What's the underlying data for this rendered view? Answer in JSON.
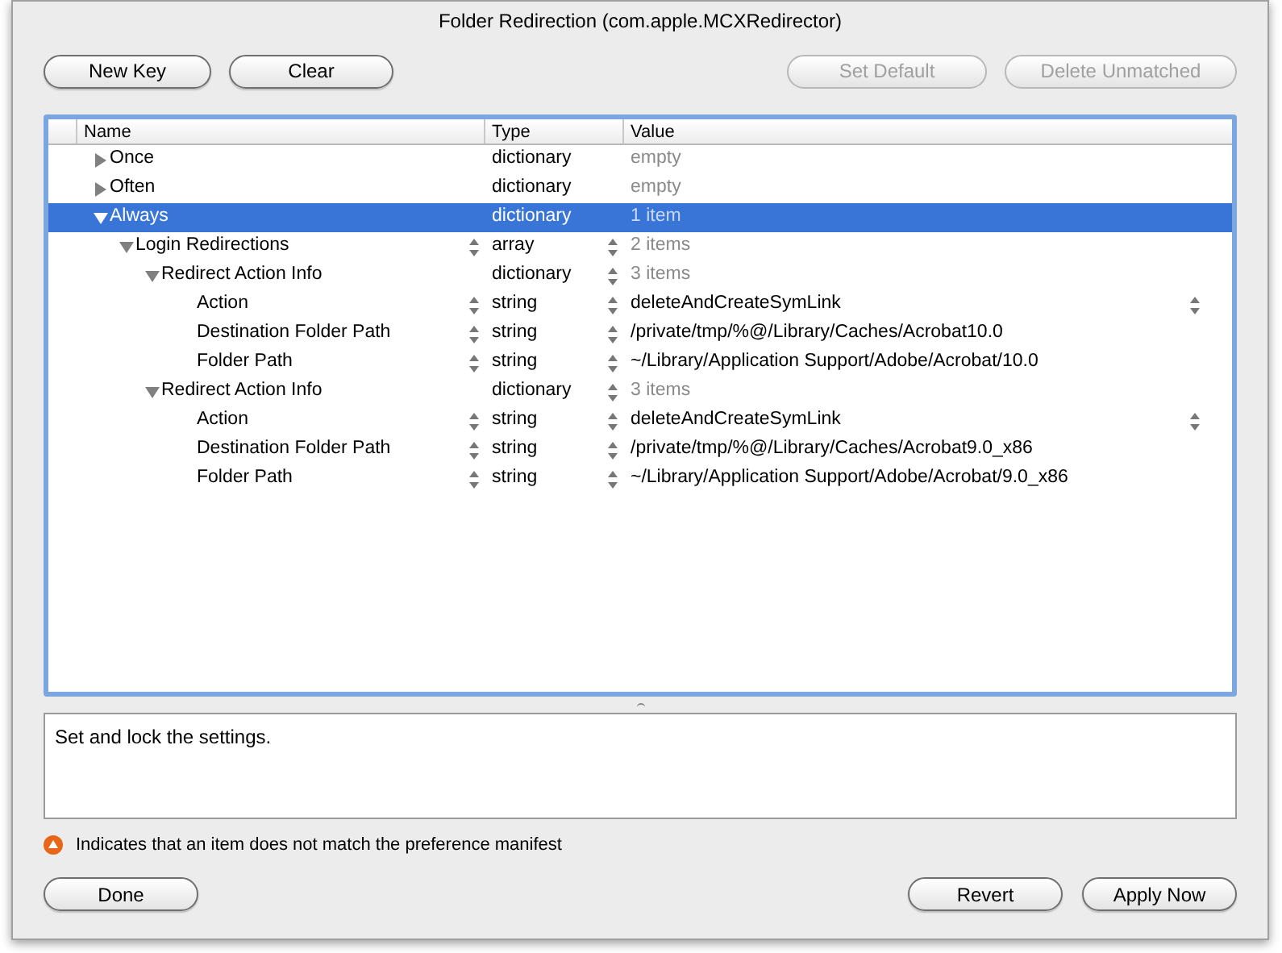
{
  "window": {
    "title": "Folder Redirection (com.apple.MCXRedirector)"
  },
  "toolbar": [
    {
      "label": "New Key",
      "disabled": false
    },
    {
      "label": "Clear",
      "disabled": false
    },
    {
      "label": "Set Default",
      "disabled": true
    },
    {
      "label": "Delete Unmatched",
      "disabled": true
    }
  ],
  "table": {
    "columns": [
      "Name",
      "Type",
      "Value"
    ],
    "rows": [
      {
        "name": "Once",
        "type": "dictionary",
        "value": "empty",
        "kind": "summary",
        "expanded": false,
        "selected": false
      },
      {
        "name": "Often",
        "type": "dictionary",
        "value": "empty",
        "kind": "summary",
        "expanded": false,
        "selected": false
      },
      {
        "name": "Always",
        "type": "dictionary",
        "value": "1 item",
        "kind": "summary",
        "expanded": true,
        "selected": true,
        "children": [
          {
            "name": "Login Redirections",
            "type": "array",
            "value": "2 items",
            "kind": "summary",
            "expanded": true,
            "selected": false,
            "name_stepper": true,
            "type_stepper": true,
            "children": [
              {
                "name": "Redirect Action Info",
                "type": "dictionary",
                "value": "3 items",
                "kind": "summary",
                "expanded": true,
                "selected": false,
                "type_stepper": true,
                "children": [
                  {
                    "name": "Action",
                    "type": "string",
                    "value": "deleteAndCreateSymLink",
                    "kind": "text",
                    "selected": false,
                    "name_stepper": true,
                    "type_stepper": true,
                    "value_popup": true
                  },
                  {
                    "name": "Destination Folder Path",
                    "type": "string",
                    "value": "/private/tmp/%@/Library/Caches/Acrobat10.0",
                    "kind": "text",
                    "selected": false,
                    "name_stepper": true,
                    "type_stepper": true
                  },
                  {
                    "name": "Folder Path",
                    "type": "string",
                    "value": "~/Library/Application Support/Adobe/Acrobat/10.0",
                    "kind": "text",
                    "selected": false,
                    "name_stepper": true,
                    "type_stepper": true
                  }
                ]
              },
              {
                "name": "Redirect Action Info",
                "type": "dictionary",
                "value": "3 items",
                "kind": "summary",
                "expanded": true,
                "selected": false,
                "type_stepper": true,
                "children": [
                  {
                    "name": "Action",
                    "type": "string",
                    "value": "deleteAndCreateSymLink",
                    "kind": "text",
                    "selected": false,
                    "name_stepper": true,
                    "type_stepper": true,
                    "value_popup": true
                  },
                  {
                    "name": "Destination Folder Path",
                    "type": "string",
                    "value": "/private/tmp/%@/Library/Caches/Acrobat9.0_x86",
                    "kind": "text",
                    "selected": false,
                    "name_stepper": true,
                    "type_stepper": true
                  },
                  {
                    "name": "Folder Path",
                    "type": "string",
                    "value": "~/Library/Application Support/Adobe/Acrobat/9.0_x86",
                    "kind": "text",
                    "selected": false,
                    "name_stepper": true,
                    "type_stepper": true
                  }
                ]
              }
            ]
          }
        ]
      }
    ]
  },
  "description": "Set and lock the settings.",
  "legend": "Indicates that an item does not match the preference manifest",
  "footer": {
    "left": [
      "Done"
    ],
    "right": [
      "Revert",
      "Apply Now"
    ]
  }
}
